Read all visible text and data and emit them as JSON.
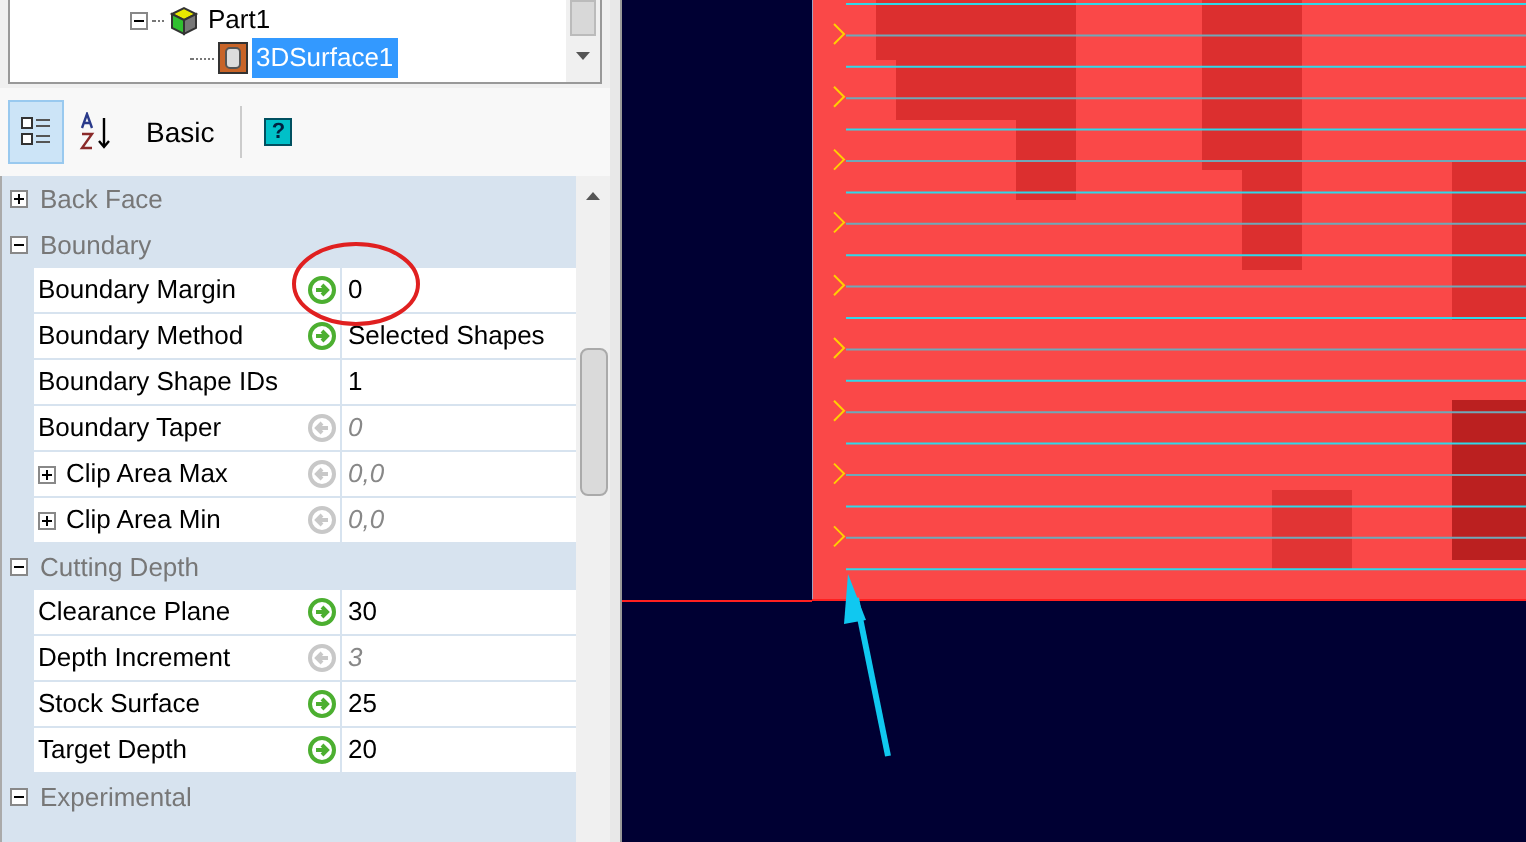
{
  "tree": {
    "items": [
      {
        "label": "Part1",
        "expanded": true,
        "selected": false,
        "children": [
          {
            "label": "3DSurface1",
            "selected": true
          }
        ]
      }
    ]
  },
  "toolbar": {
    "buttons": [
      {
        "kind": "categorized",
        "selected": true
      },
      {
        "kind": "alphabetical",
        "selected": false
      },
      {
        "kind": "text",
        "label": "Basic",
        "selected": false
      },
      {
        "kind": "help",
        "label": "?",
        "selected": false
      }
    ]
  },
  "property_grid": {
    "categories": [
      {
        "name": "Back Face",
        "expanded": false
      },
      {
        "name": "Boundary",
        "expanded": true,
        "properties": [
          {
            "name": "Boundary Margin",
            "value": "0",
            "kind": "set"
          },
          {
            "name": "Boundary Method",
            "value": "Selected Shapes",
            "kind": "set"
          },
          {
            "name": "Boundary Shape IDs",
            "value": "1",
            "kind": "plain"
          },
          {
            "name": "Boundary Taper",
            "value": "0",
            "kind": "default"
          },
          {
            "name": "Clip Area Max",
            "value": "0,0",
            "kind": "default",
            "expanded": false
          },
          {
            "name": "Clip Area Min",
            "value": "0,0",
            "kind": "default",
            "expanded": false
          }
        ]
      },
      {
        "name": "Cutting Depth",
        "expanded": true,
        "properties": [
          {
            "name": "Clearance Plane",
            "value": "30",
            "kind": "set"
          },
          {
            "name": "Depth Increment",
            "value": "3",
            "kind": "default"
          },
          {
            "name": "Stock Surface",
            "value": "25",
            "kind": "set"
          },
          {
            "name": "Target Depth",
            "value": "20",
            "kind": "set"
          }
        ]
      },
      {
        "name": "Experimental",
        "expanded": true
      }
    ]
  }
}
